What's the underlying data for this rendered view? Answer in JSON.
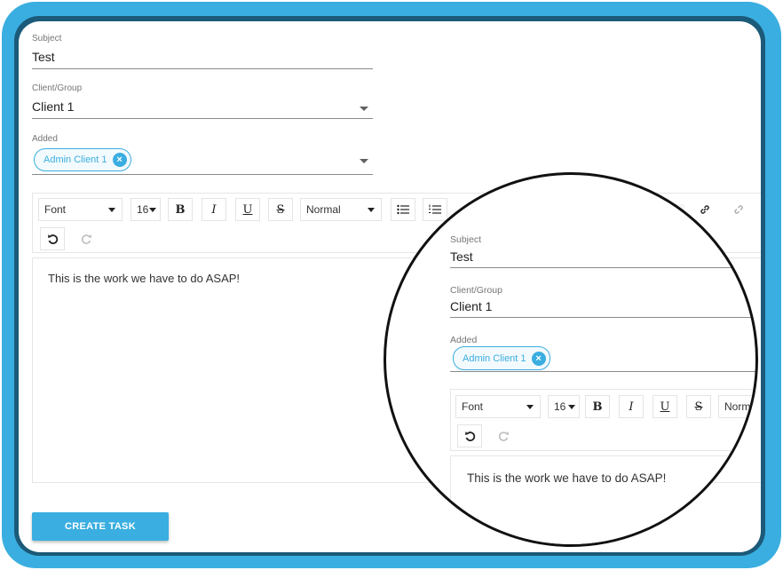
{
  "form": {
    "subject_label": "Subject",
    "subject_value": "Test",
    "client_label": "Client/Group",
    "client_value": "Client 1",
    "added_label": "Added",
    "added_chip": "Admin Client 1"
  },
  "toolbar": {
    "font_label": "Font",
    "size_label": "16",
    "bold": "B",
    "italic": "I",
    "underline": "U",
    "strike": "S",
    "heading_label": "Normal",
    "undo_icon": "undo-icon",
    "redo_icon": "redo-icon",
    "link_icon": "link-icon",
    "unlink_icon": "unlink-icon",
    "bullet_list_icon": "bullet-list-icon",
    "ordered_list_icon": "ordered-list-icon"
  },
  "editor": {
    "content": "This is the work we have to do ASAP!"
  },
  "actions": {
    "create_label": "CREATE TASK"
  },
  "colors": {
    "accent": "#3aaee0",
    "frame_dark": "#1b5a78"
  }
}
